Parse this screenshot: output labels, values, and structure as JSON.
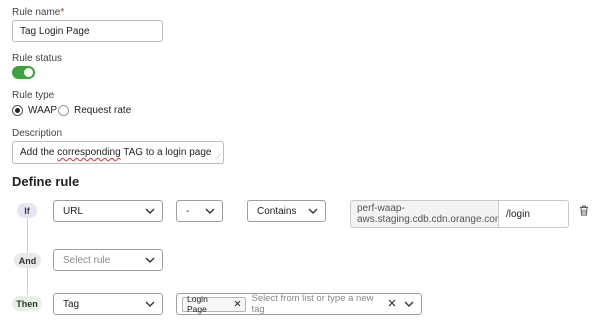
{
  "form": {
    "rule_name_label": "Rule name",
    "rule_name_required": "*",
    "rule_name_value": "Tag Login Page",
    "rule_status_label": "Rule status",
    "rule_status_on": true,
    "rule_type_label": "Rule type",
    "rule_type_options": [
      "WAAP",
      "Request rate"
    ],
    "rule_type_selected": "WAAP",
    "description_label": "Description",
    "description_pre": "Add the ",
    "description_misspelled": "corresponding",
    "description_post": " TAG to a login page"
  },
  "define_rule": {
    "title": "Define rule",
    "if_label": "If",
    "and_label": "And",
    "then_label": "Then",
    "condition": {
      "field": "URL",
      "modifier": "-",
      "operator": "Contains",
      "host_line1": "perf-waap-",
      "host_line2": "aws.staging.cdb.cdn.orange.com",
      "path": "/login"
    },
    "and_placeholder": "Select rule",
    "action": {
      "type": "Tag",
      "tag_chip": "Login Page",
      "tag_placeholder": "Select from list or type a new tag"
    }
  },
  "icons": {
    "chevron": "chevron-down-icon",
    "delete": "trash-icon",
    "remove": "close-icon"
  },
  "colors": {
    "toggle_on": "#3ea33e",
    "required": "#c0392b",
    "if_pill": "#e6e3f3",
    "then_pill": "#e3f2e3"
  }
}
